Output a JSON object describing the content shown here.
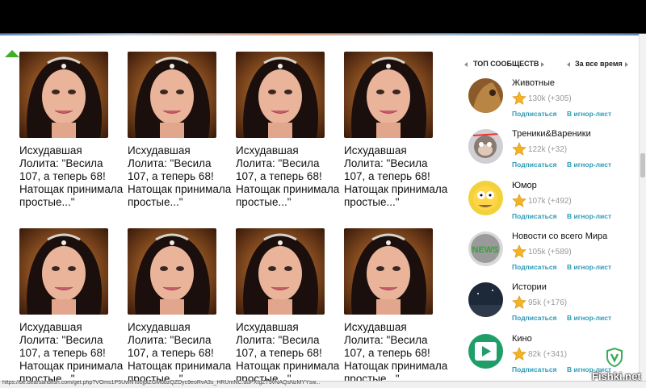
{
  "grid": {
    "cards": [
      {
        "title": "Исхудавшая Лолита: \"Весила 107, а теперь 68! Натощак принимала простые...\""
      },
      {
        "title": "Исхудавшая Лолита: \"Весила 107, а теперь 68! Натощак принимала простые...\""
      },
      {
        "title": "Исхудавшая Лолита: \"Весила 107, а теперь 68! Натощак принимала простые...\""
      },
      {
        "title": "Исхудавшая Лолита: \"Весила 107, а теперь 68! Натощак принимала простые...\""
      },
      {
        "title": "Исхудавшая Лолита: \"Весила 107, а теперь 68! Натощак принимала простые...\""
      },
      {
        "title": "Исхудавшая Лолита: \"Весила 107, а теперь 68! Натощак принимала простые...\""
      },
      {
        "title": "Исхудавшая Лолита: \"Весила 107, а теперь 68! Натощак принимала простые...\""
      },
      {
        "title": "Исхудавшая Лолита: \"Весила 107, а теперь 68! Натощак принимала простые...\""
      }
    ]
  },
  "sidebar": {
    "heading": "ТОП СООБЩЕСТВ",
    "period": "За все время",
    "subscribe_label": "Подписаться",
    "ignore_label": "В игнор-лист",
    "communities": [
      {
        "name": "Животные",
        "count": "130k (+305)",
        "icon": "animals-avatar"
      },
      {
        "name": "Треники&Вареники",
        "count": "122k (+32)",
        "icon": "monkey-avatar"
      },
      {
        "name": "Юмор",
        "count": "107k (+492)",
        "icon": "cartoon-avatar"
      },
      {
        "name": "Новости со всего Мира",
        "count": "105k (+589)",
        "icon": "news-avatar"
      },
      {
        "name": "Истории",
        "count": "95k (+176)",
        "icon": "night-sky-avatar"
      },
      {
        "name": "Кино",
        "count": "82k (+341)",
        "icon": "film-avatar"
      }
    ]
  },
  "status": {
    "url": "https://be.bearsandfish.com/get.php?VOms1P5UwNTo0jpiZGM6bzQZDyc9eoRvA3s_HRUmNC.duPXtgZT9vNAQsNzMYYsw..."
  },
  "watermark": "Fishki.net",
  "colors": {
    "link": "#2d9bb8",
    "star": "#f5b324",
    "scroll_arrow": "#3fae29"
  }
}
